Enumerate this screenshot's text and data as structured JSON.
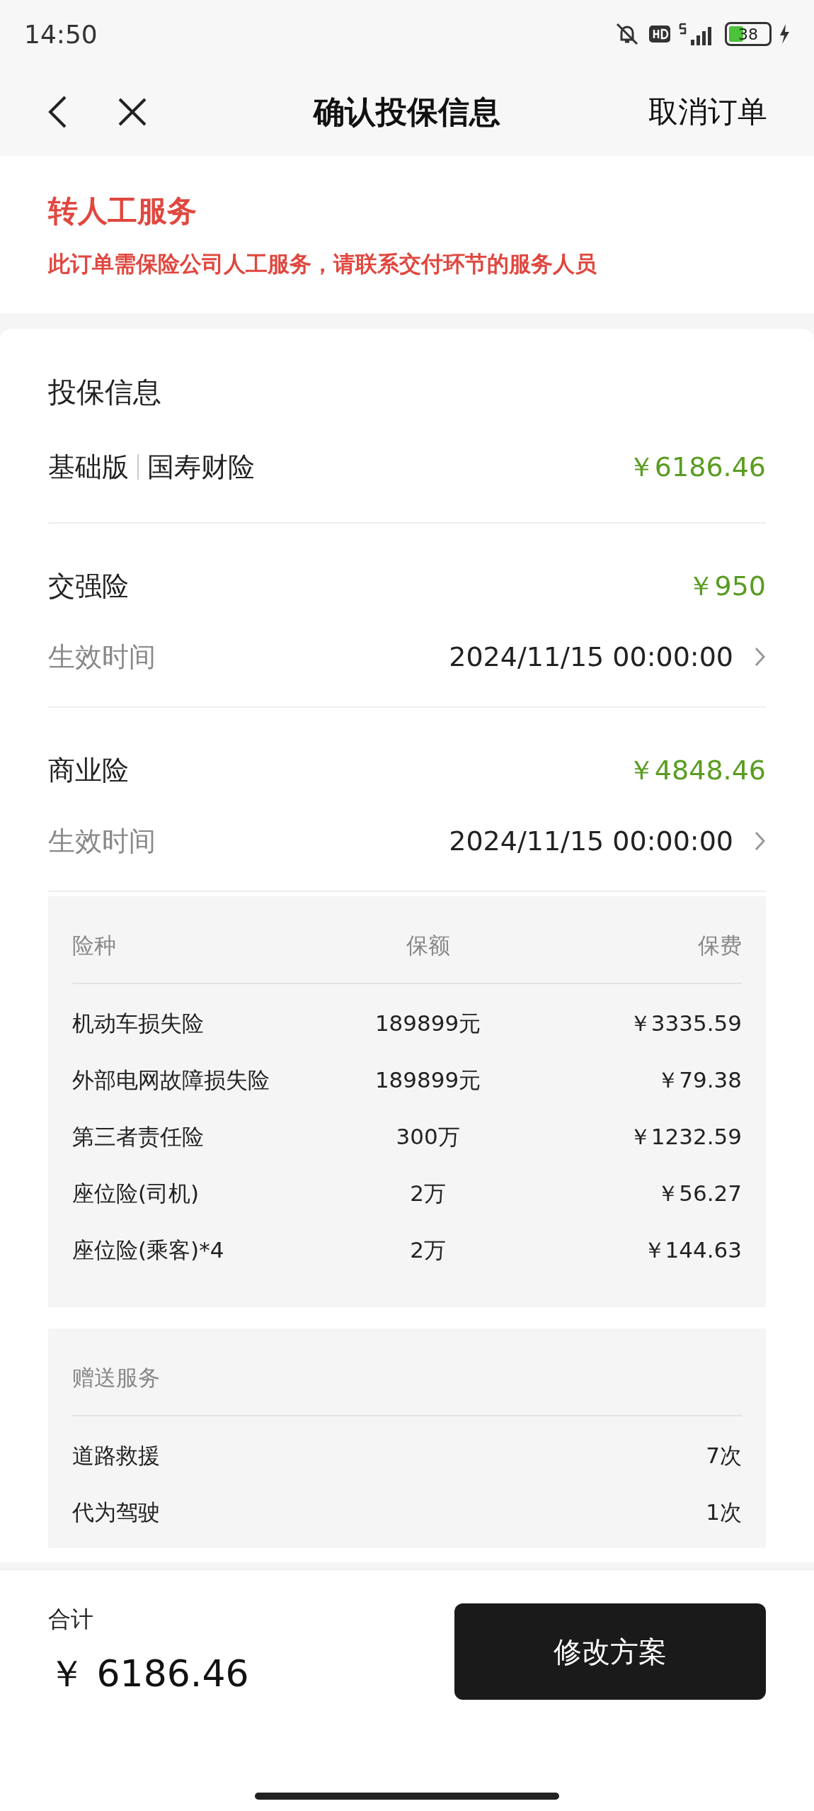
{
  "status_bar": {
    "time": "14:50",
    "battery": "38"
  },
  "header": {
    "title": "确认投保信息",
    "action": "取消订单"
  },
  "notice": {
    "title": "转人工服务",
    "message": "此订单需保险公司人工服务，请联系交付环节的服务人员"
  },
  "info": {
    "title": "投保信息",
    "plan": "基础版",
    "insurer": "国寿财险",
    "total": "￥6186.46",
    "sections": [
      {
        "name": "交强险",
        "price": "￥950",
        "date_label": "生效时间",
        "date": "2024/11/15 00:00:00"
      },
      {
        "name": "商业险",
        "price": "￥4848.46",
        "date_label": "生效时间",
        "date": "2024/11/15 00:00:00"
      }
    ],
    "coverage": {
      "columns": [
        "险种",
        "保额",
        "保费"
      ],
      "rows": [
        [
          "机动车损失险",
          "189899元",
          "￥3335.59"
        ],
        [
          "外部电网故障损失险",
          "189899元",
          "￥79.38"
        ],
        [
          "第三者责任险",
          "300万",
          "￥1232.59"
        ],
        [
          "座位险(司机)",
          "2万",
          "￥56.27"
        ],
        [
          "座位险(乘客)*4",
          "2万",
          "￥144.63"
        ]
      ]
    },
    "gifts": {
      "title": "赠送服务",
      "rows": [
        [
          "道路救援",
          "7次"
        ],
        [
          "代为驾驶",
          "1次"
        ]
      ]
    }
  },
  "footer": {
    "label": "合计",
    "total": "￥ 6186.46",
    "button": "修改方案"
  }
}
